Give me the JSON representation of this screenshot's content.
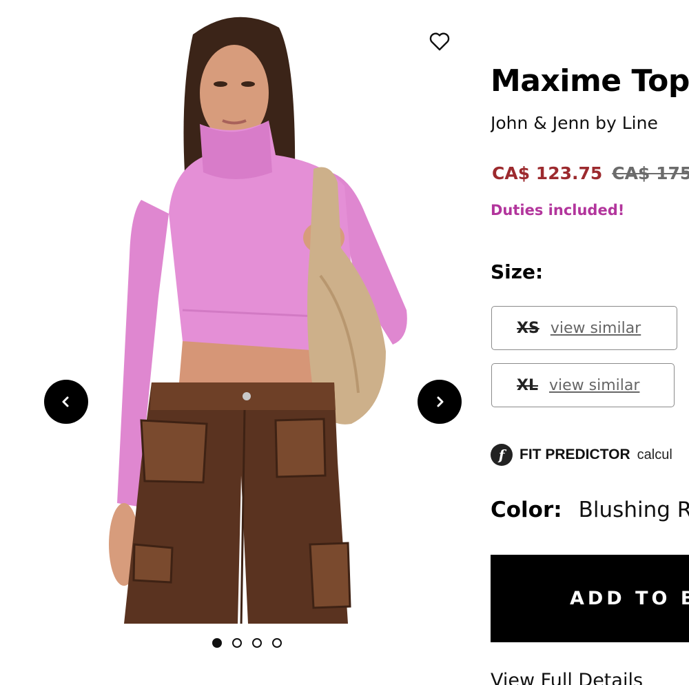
{
  "product": {
    "title": "Maxime Top",
    "brand": "John & Jenn by Line",
    "price_sale": "CA$ 123.75",
    "price_original": "CA$ 175",
    "duties_note": "Duties included!",
    "size_label": "Size:",
    "sizes": [
      {
        "code": "XS",
        "link": "view similar"
      },
      {
        "code": "XL",
        "link": "view similar"
      }
    ],
    "fit_predictor": {
      "badge": "f",
      "title": "FIT PREDICTOR",
      "text": "calcul"
    },
    "color_label": "Color:",
    "color_value": "Blushing R",
    "add_to_bag": "ADD TO BA",
    "view_details": "View Full Details"
  },
  "gallery": {
    "image_count": 4,
    "active_index": 0
  },
  "colors": {
    "sale_price": "#9c2a2e",
    "duties": "#b2359c",
    "sweater": "#e48fd6",
    "pants": "#5a3320",
    "bag": "#cdb08a",
    "button": "#000000"
  },
  "icons": {
    "favorite": "heart-outline-icon",
    "prev": "chevron-left-icon",
    "next": "chevron-right-icon"
  }
}
